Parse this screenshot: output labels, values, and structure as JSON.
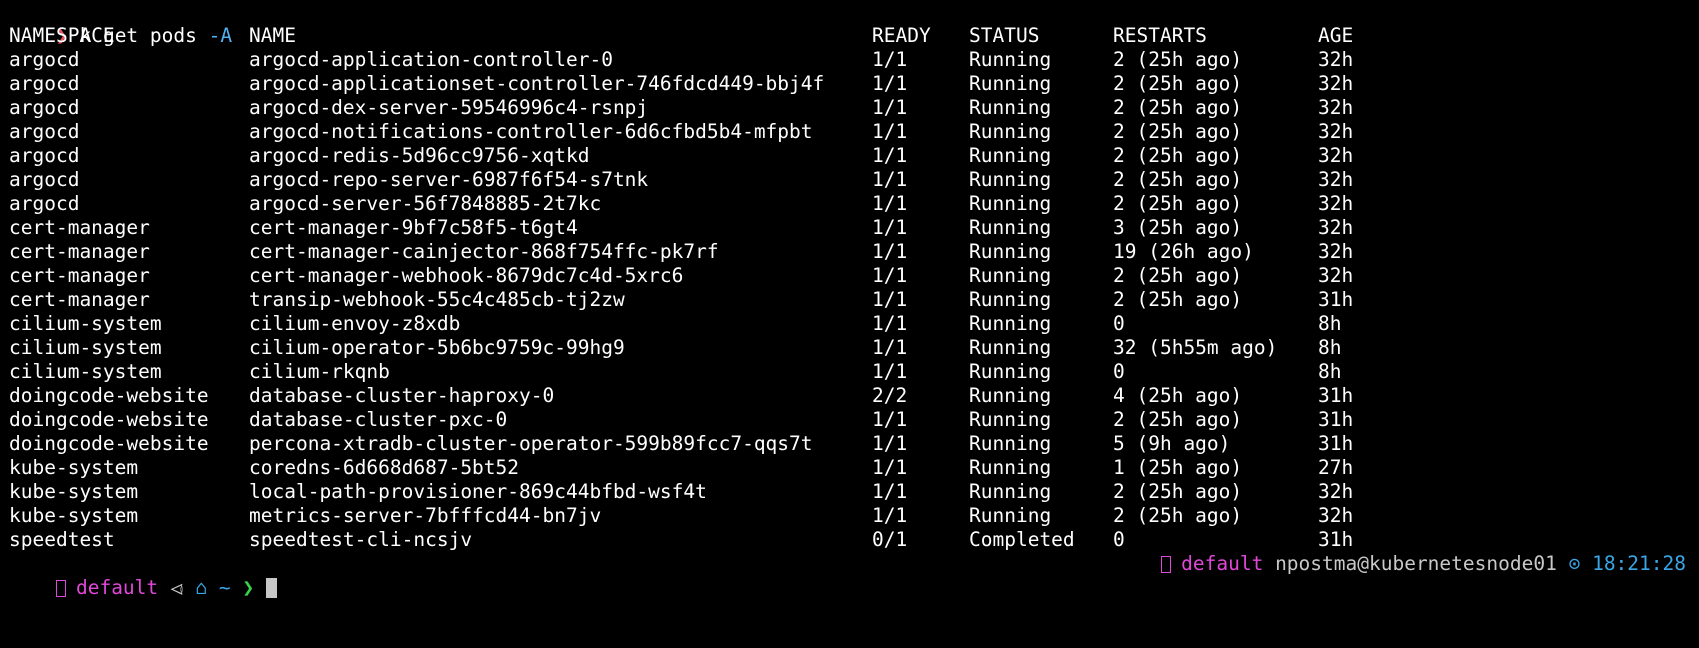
{
  "prompt": {
    "arrow": "❯",
    "command": "k get pods",
    "flag": "-A"
  },
  "colors": {
    "background": "#000000",
    "text": "#ffffff",
    "arrow": "#e8545a",
    "flag": "#4fb2f0",
    "context": "#e048d8",
    "home": "#3aa6e6",
    "chevron": "#37d44a"
  },
  "table": {
    "headers": {
      "namespace": "NAMESPACE",
      "name": "NAME",
      "ready": "READY",
      "status": "STATUS",
      "restarts": "RESTARTS",
      "age": "AGE"
    },
    "rows": [
      {
        "namespace": "argocd",
        "name": "argocd-application-controller-0",
        "ready": "1/1",
        "status": "Running",
        "restarts": "2 (25h ago)",
        "age": "32h"
      },
      {
        "namespace": "argocd",
        "name": "argocd-applicationset-controller-746fdcd449-bbj4f",
        "ready": "1/1",
        "status": "Running",
        "restarts": "2 (25h ago)",
        "age": "32h"
      },
      {
        "namespace": "argocd",
        "name": "argocd-dex-server-59546996c4-rsnpj",
        "ready": "1/1",
        "status": "Running",
        "restarts": "2 (25h ago)",
        "age": "32h"
      },
      {
        "namespace": "argocd",
        "name": "argocd-notifications-controller-6d6cfbd5b4-mfpbt",
        "ready": "1/1",
        "status": "Running",
        "restarts": "2 (25h ago)",
        "age": "32h"
      },
      {
        "namespace": "argocd",
        "name": "argocd-redis-5d96cc9756-xqtkd",
        "ready": "1/1",
        "status": "Running",
        "restarts": "2 (25h ago)",
        "age": "32h"
      },
      {
        "namespace": "argocd",
        "name": "argocd-repo-server-6987f6f54-s7tnk",
        "ready": "1/1",
        "status": "Running",
        "restarts": "2 (25h ago)",
        "age": "32h"
      },
      {
        "namespace": "argocd",
        "name": "argocd-server-56f7848885-2t7kc",
        "ready": "1/1",
        "status": "Running",
        "restarts": "2 (25h ago)",
        "age": "32h"
      },
      {
        "namespace": "cert-manager",
        "name": "cert-manager-9bf7c58f5-t6gt4",
        "ready": "1/1",
        "status": "Running",
        "restarts": "3 (25h ago)",
        "age": "32h"
      },
      {
        "namespace": "cert-manager",
        "name": "cert-manager-cainjector-868f754ffc-pk7rf",
        "ready": "1/1",
        "status": "Running",
        "restarts": "19 (26h ago)",
        "age": "32h"
      },
      {
        "namespace": "cert-manager",
        "name": "cert-manager-webhook-8679dc7c4d-5xrc6",
        "ready": "1/1",
        "status": "Running",
        "restarts": "2 (25h ago)",
        "age": "32h"
      },
      {
        "namespace": "cert-manager",
        "name": "transip-webhook-55c4c485cb-tj2zw",
        "ready": "1/1",
        "status": "Running",
        "restarts": "2 (25h ago)",
        "age": "31h"
      },
      {
        "namespace": "cilium-system",
        "name": "cilium-envoy-z8xdb",
        "ready": "1/1",
        "status": "Running",
        "restarts": "0",
        "age": "8h"
      },
      {
        "namespace": "cilium-system",
        "name": "cilium-operator-5b6bc9759c-99hg9",
        "ready": "1/1",
        "status": "Running",
        "restarts": "32 (5h55m ago)",
        "age": "8h"
      },
      {
        "namespace": "cilium-system",
        "name": "cilium-rkqnb",
        "ready": "1/1",
        "status": "Running",
        "restarts": "0",
        "age": "8h"
      },
      {
        "namespace": "doingcode-website",
        "name": "database-cluster-haproxy-0",
        "ready": "2/2",
        "status": "Running",
        "restarts": "4 (25h ago)",
        "age": "31h"
      },
      {
        "namespace": "doingcode-website",
        "name": "database-cluster-pxc-0",
        "ready": "1/1",
        "status": "Running",
        "restarts": "2 (25h ago)",
        "age": "31h"
      },
      {
        "namespace": "doingcode-website",
        "name": "percona-xtradb-cluster-operator-599b89fcc7-qqs7t",
        "ready": "1/1",
        "status": "Running",
        "restarts": "5 (9h ago)",
        "age": "31h"
      },
      {
        "namespace": "kube-system",
        "name": "coredns-6d668d687-5bt52",
        "ready": "1/1",
        "status": "Running",
        "restarts": "1 (25h ago)",
        "age": "27h"
      },
      {
        "namespace": "kube-system",
        "name": "local-path-provisioner-869c44bfbd-wsf4t",
        "ready": "1/1",
        "status": "Running",
        "restarts": "2 (25h ago)",
        "age": "32h"
      },
      {
        "namespace": "kube-system",
        "name": "metrics-server-7bfffcd44-bn7jv",
        "ready": "1/1",
        "status": "Running",
        "restarts": "2 (25h ago)",
        "age": "32h"
      },
      {
        "namespace": "speedtest",
        "name": "speedtest-cli-ncsjv",
        "ready": "0/1",
        "status": "Completed",
        "restarts": "0",
        "age": "31h"
      }
    ]
  },
  "status_bar": {
    "context": "default",
    "home": "~",
    "chevron": "❯",
    "right_context": "default",
    "user_host": "npostma@kubernetesnode01",
    "clock_icon": "⊙",
    "time": "18:21:28"
  }
}
